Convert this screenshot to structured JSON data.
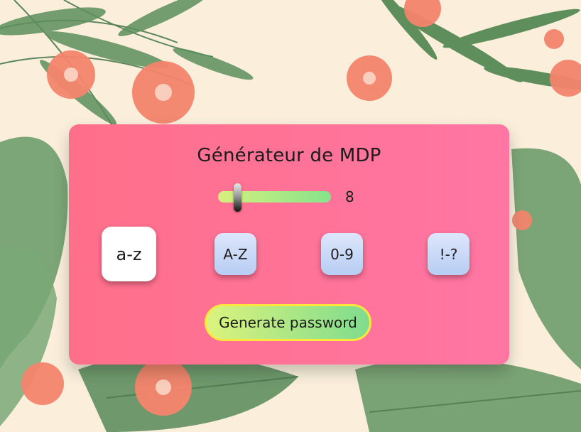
{
  "app": {
    "title": "Générateur de MDP",
    "length_value": "8",
    "length_fraction": 0.15,
    "options": [
      {
        "label": "a-z",
        "active": true
      },
      {
        "label": "A-Z",
        "active": false
      },
      {
        "label": "0-9",
        "active": false
      },
      {
        "label": "!-?",
        "active": false
      }
    ],
    "generate_label": "Generate password"
  },
  "colors": {
    "card_start": "#ff6f8a",
    "card_end": "#ff76a4",
    "slider_start": "#d6f07e",
    "slider_end": "#86e38c",
    "button_border": "#ffe63d"
  }
}
